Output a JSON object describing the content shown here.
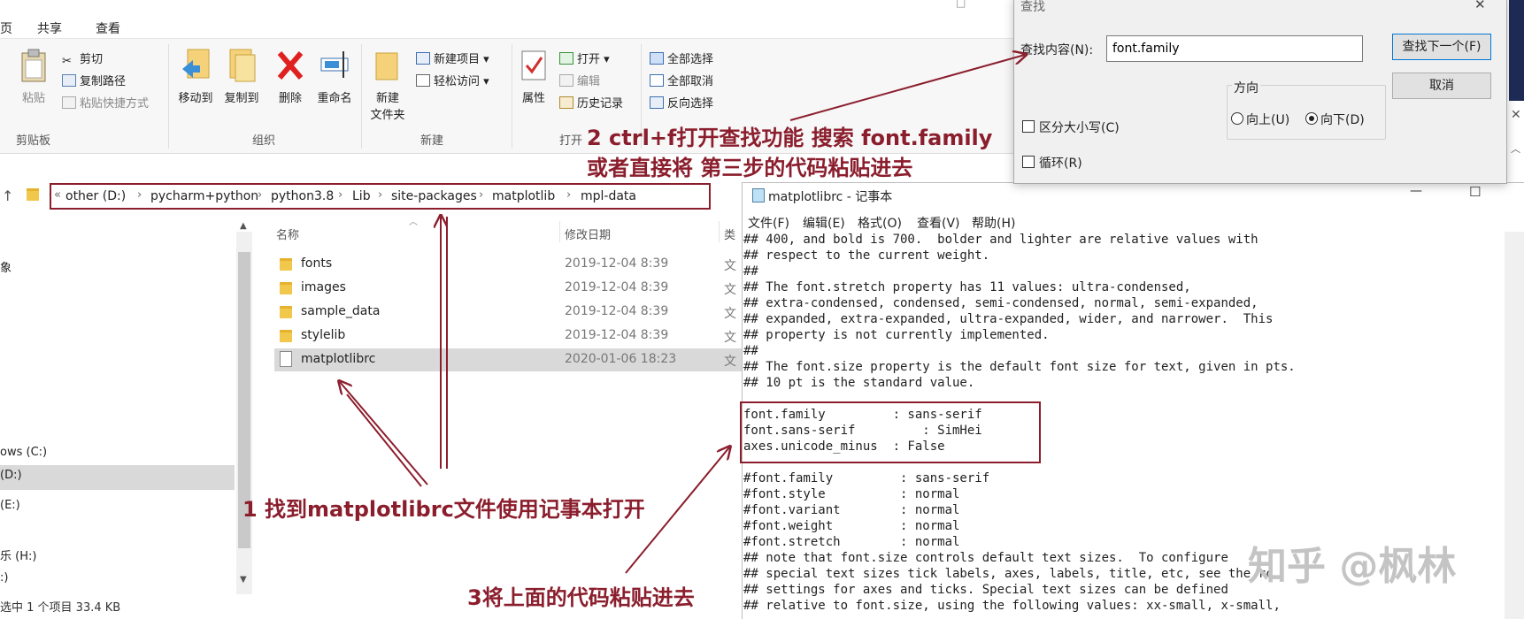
{
  "ribbon": {
    "tabs": [
      "页",
      "共享",
      "查看"
    ],
    "clipboard": {
      "label": "剪贴板",
      "paste": "粘贴",
      "cut": "剪切",
      "copy_path": "复制路径",
      "paste_shortcut": "粘贴快捷方式"
    },
    "organize": {
      "label": "组织",
      "move_to": "移动到",
      "copy_to": "复制到",
      "delete": "删除",
      "rename": "重命名"
    },
    "new": {
      "label": "新建",
      "new_folder": "新建\n文件夹",
      "new_item": "新建项目",
      "easy_access": "轻松访问"
    },
    "open": {
      "label": "打开",
      "properties": "属性",
      "open": "打开",
      "edit": "编辑",
      "history": "历史记录"
    },
    "select": {
      "select_all": "全部选择",
      "select_none": "全部取消",
      "invert": "反向选择"
    }
  },
  "address": {
    "crumbs": [
      "other (D:)",
      "pycharm+python",
      "python3.8",
      "Lib",
      "site-packages",
      "matplotlib",
      "mpl-data"
    ],
    "overflow": "«"
  },
  "nav": {
    "items": [
      "象",
      "ows (C:)",
      "(D:)",
      "(E:)",
      "乐 (H:)",
      ":)"
    ]
  },
  "filelist": {
    "headers": {
      "name": "名称",
      "modified": "修改日期",
      "type": "类"
    },
    "rows": [
      {
        "name": "fonts",
        "date": "2019-12-04 8:39",
        "type": "文",
        "kind": "folder"
      },
      {
        "name": "images",
        "date": "2019-12-04 8:39",
        "type": "文",
        "kind": "folder"
      },
      {
        "name": "sample_data",
        "date": "2019-12-04 8:39",
        "type": "文",
        "kind": "folder"
      },
      {
        "name": "stylelib",
        "date": "2019-12-04 8:39",
        "type": "文",
        "kind": "folder"
      },
      {
        "name": "matplotlibrc",
        "date": "2020-01-06 18:23",
        "type": "文",
        "kind": "file"
      }
    ]
  },
  "status": {
    "text": "选中 1 个项目  33.4 KB"
  },
  "notepad": {
    "title": "matplotlibrc - 记事本",
    "menu": [
      "文件(F)",
      "编辑(E)",
      "格式(O)",
      "查看(V)",
      "帮助(H)"
    ],
    "lines": [
      "## 400, and bold is 700.  bolder and lighter are relative values with",
      "## respect to the current weight.",
      "##",
      "## The font.stretch property has 11 values: ultra-condensed,",
      "## extra-condensed, condensed, semi-condensed, normal, semi-expanded,",
      "## expanded, extra-expanded, ultra-expanded, wider, and narrower.  This",
      "## property is not currently implemented.",
      "##",
      "## The font.size property is the default font size for text, given in pts.",
      "## 10 pt is the standard value.",
      "",
      "font.family         : sans-serif",
      "font.sans-serif         : SimHei",
      "axes.unicode_minus  : False",
      "",
      "#font.family         : sans-serif",
      "#font.style          : normal",
      "#font.variant        : normal",
      "#font.weight         : normal",
      "#font.stretch        : normal",
      "## note that font.size controls default text sizes.  To configure",
      "## special text sizes tick labels, axes, labels, title, etc, see the rc",
      "## settings for axes and ticks. Special text sizes can be defined",
      "## relative to font.size, using the following values: xx-small, x-small,"
    ]
  },
  "find": {
    "title": "查找",
    "find_what_label": "查找内容(N):",
    "find_what_value": "font.family",
    "find_next": "查找下一个(F)",
    "cancel": "取消",
    "direction_label": "方向",
    "up": "向上(U)",
    "down": "向下(D)",
    "match_case": "区分大小写(C)",
    "wrap": "循环(R)"
  },
  "annotations": {
    "step1": "1 找到matplotlibrc文件使用记事本打开",
    "step2_line1": "2 ctrl+f打开查找功能 搜索 font.family",
    "step2_line2": "或者直接将 第三步的代码粘贴进去",
    "step3": "3将上面的代码粘贴进去",
    "color": "#8b1e2d"
  },
  "watermark": "知乎 @枫林",
  "window_controls": {
    "minimize": "—",
    "maximize": "☐",
    "close": "✕"
  }
}
